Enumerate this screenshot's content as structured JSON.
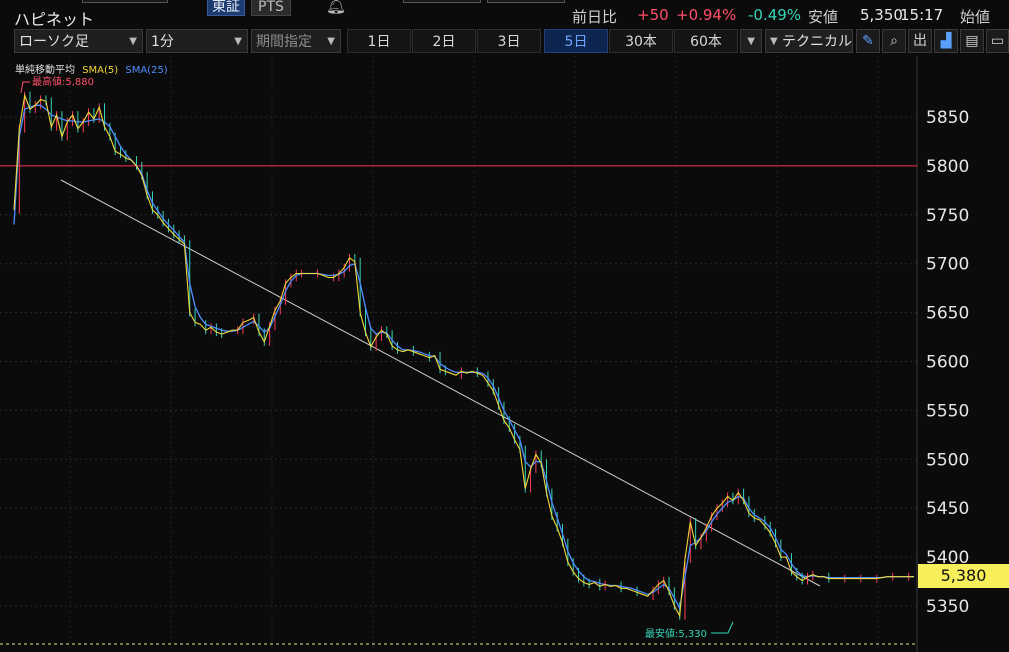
{
  "header": {
    "stock_name": "ハピネット",
    "market_tse": "東証",
    "market_pts": "PTS",
    "prev_day_label": "前日比",
    "change_abs": "+50",
    "change_pct": "+0.94%",
    "change_other": "-0.49%",
    "low_label": "安値",
    "low_value": "5,350",
    "time": "15:17",
    "open_label": "始値"
  },
  "toolbar": {
    "chart_type": "ローソク足",
    "interval": "1分",
    "period_placeholder": "期間指定",
    "ranges": [
      "1日",
      "2日",
      "3日",
      "5日",
      "30本",
      "60本"
    ],
    "active_range": "5日",
    "technical": "テクニカル"
  },
  "colors": {
    "background": "#0b0b0b",
    "sma5": "#f0d83a",
    "sma25": "#4f8dff",
    "up": "#ff3b55",
    "down": "#35d6b8",
    "ref_line": "#ff2d4a",
    "active_tab": "#0e2550",
    "price_tag": "#f6ef5a"
  },
  "chart_data": {
    "type": "line",
    "legend": {
      "title": "単純移動平均",
      "sma5": "SMA(5)",
      "sma25": "SMA(25)"
    },
    "y_ticks": [
      5350,
      5400,
      5450,
      5500,
      5550,
      5600,
      5650,
      5700,
      5750,
      5800,
      5850
    ],
    "ylim": [
      5312,
      5900
    ],
    "reference_line": 5800,
    "max_label": "最高値:5,880",
    "min_label": "最安値:5,330",
    "current_price_label": "5,380",
    "n_points": 170,
    "sma5_series": [
      5755,
      5838,
      5872,
      5858,
      5862,
      5868,
      5866,
      5840,
      5852,
      5830,
      5845,
      5852,
      5838,
      5845,
      5855,
      5848,
      5860,
      5840,
      5830,
      5815,
      5812,
      5808,
      5806,
      5800,
      5790,
      5770,
      5755,
      5750,
      5742,
      5736,
      5730,
      5725,
      5720,
      5650,
      5640,
      5638,
      5632,
      5635,
      5630,
      5628,
      5630,
      5632,
      5632,
      5640,
      5642,
      5645,
      5630,
      5620,
      5636,
      5652,
      5662,
      5680,
      5686,
      5690,
      5690,
      5690,
      5690,
      5690,
      5688,
      5686,
      5686,
      5690,
      5696,
      5706,
      5702,
      5650,
      5630,
      5615,
      5625,
      5632,
      5628,
      5616,
      5612,
      5610,
      5612,
      5610,
      5608,
      5606,
      5604,
      5606,
      5592,
      5590,
      5588,
      5586,
      5590,
      5588,
      5590,
      5588,
      5586,
      5578,
      5570,
      5555,
      5540,
      5532,
      5520,
      5510,
      5470,
      5490,
      5505,
      5496,
      5466,
      5442,
      5430,
      5415,
      5395,
      5385,
      5378,
      5374,
      5372,
      5374,
      5370,
      5372,
      5370,
      5371,
      5368,
      5368,
      5366,
      5364,
      5362,
      5360,
      5366,
      5372,
      5376,
      5365,
      5350,
      5340,
      5398,
      5436,
      5412,
      5420,
      5430,
      5442,
      5450,
      5455,
      5462,
      5458,
      5466,
      5458,
      5445,
      5440,
      5438,
      5432,
      5425,
      5414,
      5400,
      5400,
      5385,
      5380,
      5376,
      5380,
      5382,
      5380,
      5380,
      5378,
      5378,
      5378,
      5378,
      5378,
      5378,
      5378,
      5378,
      5378,
      5378,
      5379,
      5380,
      5380,
      5380,
      5380,
      5380,
      5380
    ],
    "sma25_series": [
      5740,
      5830,
      5858,
      5860,
      5862,
      5862,
      5858,
      5852,
      5850,
      5848,
      5846,
      5846,
      5845,
      5845,
      5846,
      5847,
      5848,
      5845,
      5840,
      5830,
      5820,
      5812,
      5806,
      5800,
      5792,
      5775,
      5762,
      5754,
      5746,
      5740,
      5734,
      5728,
      5722,
      5680,
      5656,
      5645,
      5638,
      5636,
      5634,
      5632,
      5631,
      5631,
      5632,
      5635,
      5638,
      5641,
      5636,
      5630,
      5634,
      5646,
      5658,
      5672,
      5682,
      5688,
      5690,
      5690,
      5690,
      5690,
      5689,
      5688,
      5688,
      5689,
      5692,
      5698,
      5700,
      5680,
      5655,
      5634,
      5628,
      5630,
      5629,
      5622,
      5616,
      5612,
      5612,
      5611,
      5610,
      5608,
      5606,
      5605,
      5598,
      5594,
      5591,
      5589,
      5589,
      5589,
      5589,
      5589,
      5588,
      5583,
      5575,
      5563,
      5550,
      5540,
      5530,
      5520,
      5498,
      5492,
      5498,
      5497,
      5478,
      5456,
      5440,
      5424,
      5406,
      5394,
      5386,
      5380,
      5376,
      5375,
      5373,
      5372,
      5371,
      5371,
      5370,
      5369,
      5368,
      5366,
      5364,
      5362,
      5364,
      5368,
      5372,
      5368,
      5358,
      5348,
      5380,
      5412,
      5415,
      5420,
      5427,
      5436,
      5444,
      5450,
      5456,
      5458,
      5462,
      5460,
      5450,
      5443,
      5440,
      5436,
      5430,
      5420,
      5408,
      5403,
      5393,
      5386,
      5381,
      5380,
      5381,
      5380,
      5380,
      5379,
      5379,
      5379,
      5379,
      5379,
      5379,
      5379,
      5379,
      5379,
      5379,
      5379,
      5380,
      5380,
      5380,
      5380,
      5380,
      5380
    ]
  }
}
